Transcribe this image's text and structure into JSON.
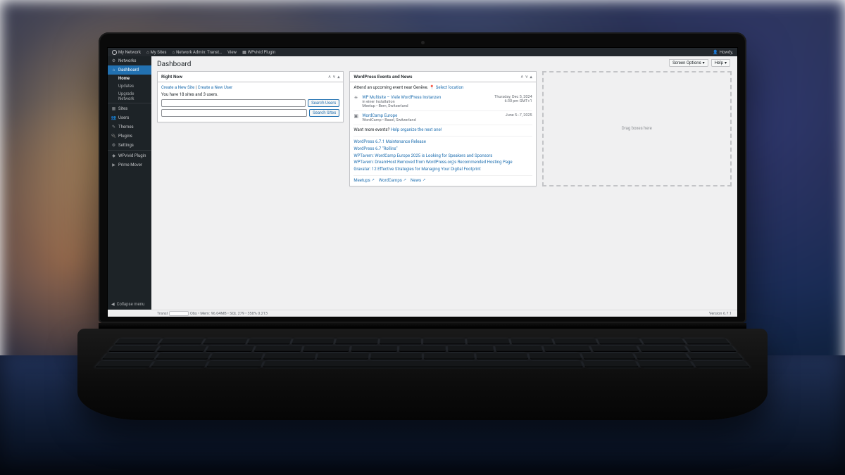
{
  "adminbar": {
    "my_network": "My Network",
    "my_sites": "My Sites",
    "network_admin": "Network Admin: Transt…",
    "view": "View",
    "plugin": "WPvivid Plugin",
    "howdy": "Howdy,",
    "screen_options": "Screen Options",
    "help": "Help"
  },
  "sidebar": {
    "networks": "Networks",
    "dashboard": "Dashboard",
    "submenu": {
      "home": "Home",
      "updates": "Updates",
      "upgrade": "Upgrade Network"
    },
    "sites": "Sites",
    "users": "Users",
    "themes": "Themes",
    "plugins": "Plugins",
    "settings": "Settings",
    "wpvivid": "WPvivid Plugin",
    "prime": "Prime Mover",
    "collapse": "Collapse menu"
  },
  "page": {
    "title": "Dashboard"
  },
  "rightnow": {
    "title": "Right Now",
    "create_site": "Create a New Site",
    "create_user": "Create a New User",
    "stat": "You have 18 sites and 3 users.",
    "search_users": "Search Users",
    "search_sites": "Search Sites"
  },
  "events": {
    "title": "WordPress Events and News",
    "intro": "Attend an upcoming event near Genève.",
    "select_location": "Select location",
    "list": [
      {
        "title": "WP Multisite – Viele WordPress Instanzen",
        "sub1": "in einer Installation",
        "sub2": "Meetup • Bern, Switzerland",
        "date1": "Thursday, Dec 5, 2024",
        "date2": "6:30 pm GMT+1"
      },
      {
        "title": "WordCamp Europe",
        "sub1": "",
        "sub2": "WordCamp • Basel, Switzerland",
        "date1": "June 5–7, 2025",
        "date2": ""
      }
    ],
    "more": "Want more events?",
    "more_link": "Help organize the next one!",
    "news": [
      "WordPress 6.7.1 Maintenance Release",
      "WordPress 6.7 \"Rollins\"",
      "WPTavern: WordCamp Europe 2025 is Looking for Speakers and Sponsors",
      "WPTavern: DreamHost Removed from WordPress.org's Recommended Hosting Page",
      "Gravatar: 12 Effective Strategies for Managing Your Digital Footprint"
    ],
    "footer": {
      "meetups": "Meetups",
      "wordcamps": "WordCamps",
      "news": "News"
    }
  },
  "dragzone": "Drag boxes here",
  "footer": {
    "prefix": "Transl",
    "stats": "Obs • Mem: 96.04MB • SQL 279 • 358% 0.213",
    "version": "Version 6.7.1"
  }
}
